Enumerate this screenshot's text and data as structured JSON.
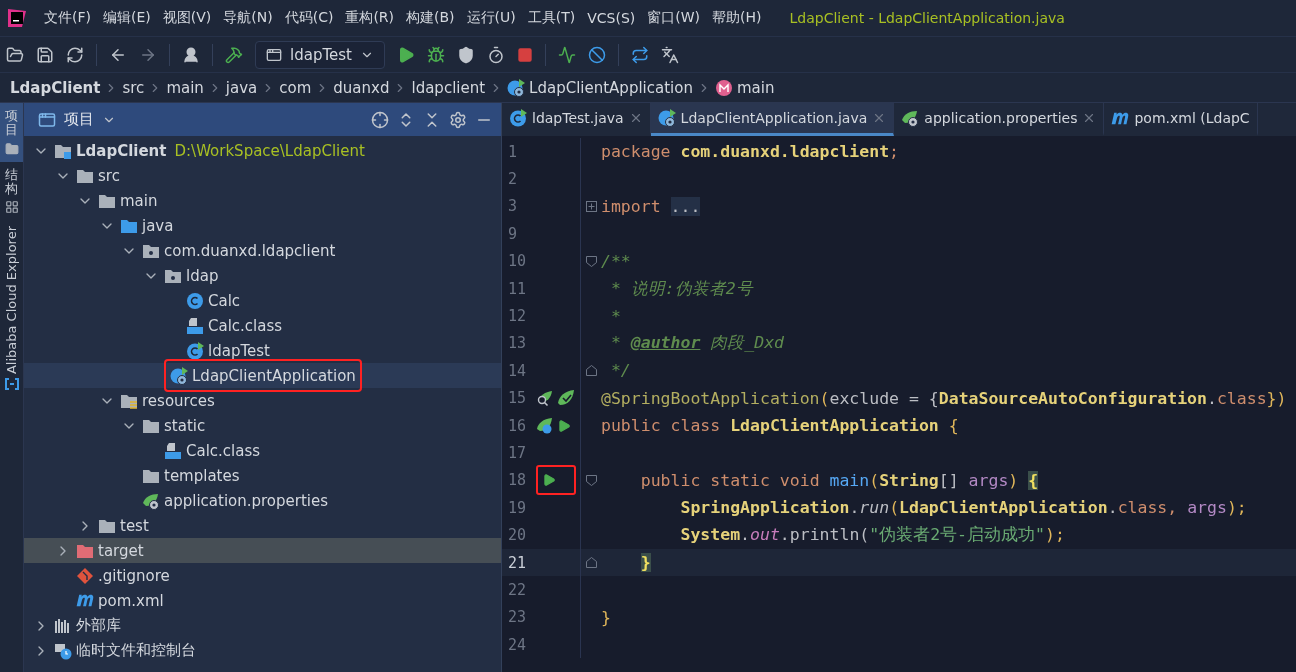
{
  "window": {
    "title": "LdapClient - LdapClientApplication.java"
  },
  "menu": [
    "文件(F)",
    "编辑(E)",
    "视图(V)",
    "导航(N)",
    "代码(C)",
    "重构(R)",
    "构建(B)",
    "运行(U)",
    "工具(T)",
    "VCS(S)",
    "窗口(W)",
    "帮助(H)"
  ],
  "toolbar": {
    "run_config": "ldapTest"
  },
  "breadcrumb": [
    {
      "label": "LdapClient",
      "kind": "project"
    },
    {
      "label": "src",
      "kind": "plain"
    },
    {
      "label": "main",
      "kind": "plain"
    },
    {
      "label": "java",
      "kind": "plain"
    },
    {
      "label": "com",
      "kind": "plain"
    },
    {
      "label": "duanxd",
      "kind": "plain"
    },
    {
      "label": "ldapclient",
      "kind": "plain"
    },
    {
      "label": "LdapClientApplication",
      "kind": "spring-class"
    },
    {
      "label": "main",
      "kind": "method"
    }
  ],
  "tool_strip": [
    {
      "label": "项目",
      "kind": "project",
      "selected": true
    },
    {
      "label": "结构",
      "kind": "structure",
      "selected": false
    },
    {
      "label": "Alibaba Cloud Explorer",
      "kind": "cloud",
      "selected": false
    }
  ],
  "project_panel": {
    "title": "项目",
    "tree": [
      {
        "label": "LdapClient",
        "path": "D:\\WorkSpace\\LdapClient",
        "kind": "module",
        "expanded": true,
        "selected": false,
        "children": [
          {
            "label": "src",
            "kind": "folder",
            "expanded": true,
            "selected": false,
            "children": [
              {
                "label": "main",
                "kind": "folder",
                "expanded": true,
                "selected": false,
                "children": [
                  {
                    "label": "java",
                    "kind": "source-folder",
                    "expanded": true,
                    "selected": false,
                    "children": [
                      {
                        "label": "com.duanxd.ldapclient",
                        "kind": "package",
                        "expanded": true,
                        "selected": false,
                        "children": [
                          {
                            "label": "ldap",
                            "kind": "package",
                            "expanded": true,
                            "selected": false,
                            "children": [
                              {
                                "label": "Calc",
                                "kind": "class",
                                "selected": false
                              },
                              {
                                "label": "Calc.class",
                                "kind": "class-file",
                                "selected": false
                              },
                              {
                                "label": "ldapTest",
                                "kind": "runnable-class",
                                "selected": false
                              }
                            ]
                          },
                          {
                            "label": "LdapClientApplication",
                            "kind": "spring-class",
                            "selected": false,
                            "hovered": true,
                            "highlighted": true
                          }
                        ]
                      }
                    ]
                  },
                  {
                    "label": "resources",
                    "kind": "resources-folder",
                    "expanded": true,
                    "selected": false,
                    "children": [
                      {
                        "label": "static",
                        "kind": "folder",
                        "expanded": true,
                        "selected": false,
                        "children": [
                          {
                            "label": "Calc.class",
                            "kind": "class-file",
                            "selected": false
                          }
                        ]
                      },
                      {
                        "label": "templates",
                        "kind": "folder",
                        "selected": false
                      },
                      {
                        "label": "application.properties",
                        "kind": "spring-props",
                        "selected": false
                      }
                    ]
                  }
                ]
              },
              {
                "label": "test",
                "kind": "folder",
                "expanded": false,
                "selected": false
              }
            ]
          },
          {
            "label": "target",
            "kind": "excluded-folder",
            "expanded": false,
            "selected": true
          },
          {
            "label": ".gitignore",
            "kind": "git",
            "selected": false
          },
          {
            "label": "pom.xml",
            "kind": "maven",
            "selected": false
          }
        ]
      },
      {
        "label": "外部库",
        "kind": "library",
        "expanded": false,
        "selected": false
      },
      {
        "label": "临时文件和控制台",
        "kind": "scratches",
        "expanded": false,
        "selected": false
      }
    ]
  },
  "editor_tabs": [
    {
      "label": "ldapTest.java",
      "kind": "runnable-class",
      "selected": false,
      "closable": true
    },
    {
      "label": "LdapClientApplication.java",
      "kind": "spring-class",
      "selected": true,
      "closable": true
    },
    {
      "label": "application.properties",
      "kind": "spring-props",
      "selected": false,
      "closable": true
    },
    {
      "label": "pom.xml (LdapC",
      "kind": "maven",
      "selected": false,
      "closable": false
    }
  ],
  "code": [
    {
      "number": "1",
      "tokens": [
        {
          "text": "package ",
          "kind": "keyword"
        },
        {
          "text": "com.duanxd.ldapclient",
          "kind": "type"
        },
        {
          "text": ";",
          "kind": "keyword"
        }
      ]
    },
    {
      "number": "2"
    },
    {
      "number": "3",
      "folded": true,
      "tokens": [
        {
          "text": "import ",
          "kind": "keyword"
        },
        {
          "text": "...",
          "kind": "folded"
        }
      ]
    },
    {
      "number": "9"
    },
    {
      "number": "10",
      "fold_start": true,
      "tokens": [
        {
          "text": "/**",
          "kind": "comment"
        }
      ]
    },
    {
      "number": "11",
      "tokens": [
        {
          "text": " * 说明:伪装者2号",
          "kind": "comment"
        }
      ]
    },
    {
      "number": "12",
      "tokens": [
        {
          "text": " *",
          "kind": "comment"
        }
      ]
    },
    {
      "number": "13",
      "tokens": [
        {
          "text": " * ",
          "kind": "comment"
        },
        {
          "text": "@author",
          "kind": "doc-tag"
        },
        {
          "text": " 肉段_Dxd",
          "kind": "comment"
        }
      ]
    },
    {
      "number": "14",
      "fold_end": true,
      "tokens": [
        {
          "text": " */",
          "kind": "comment"
        }
      ]
    },
    {
      "number": "15",
      "gutter": [
        {
          "kind": "bean-search"
        },
        {
          "kind": "bean"
        }
      ],
      "tokens": [
        {
          "text": "@SpringBootApplication",
          "kind": "annotation"
        },
        {
          "text": "(",
          "kind": "punct"
        },
        {
          "text": "exclude = ",
          "kind": "plain"
        },
        {
          "text": "{",
          "kind": "plain"
        },
        {
          "text": "DataSourceAutoConfiguration",
          "kind": "type"
        },
        {
          "text": ".",
          "kind": "plain"
        },
        {
          "text": "class",
          "kind": "keyword"
        },
        {
          "text": "})",
          "kind": "punct"
        }
      ]
    },
    {
      "number": "16",
      "gutter": [
        {
          "kind": "spring-class"
        },
        {
          "kind": "run"
        }
      ],
      "tokens": [
        {
          "text": "public class ",
          "kind": "keyword"
        },
        {
          "text": "LdapClientApplication",
          "kind": "type"
        },
        {
          "text": " {",
          "kind": "punct"
        }
      ]
    },
    {
      "number": "17"
    },
    {
      "number": "18",
      "gutter": [
        {
          "kind": "run"
        }
      ],
      "highlighted": true,
      "fold_start": true,
      "tokens": [
        {
          "text": "    public static void ",
          "kind": "keyword"
        },
        {
          "text": "main",
          "kind": "method"
        },
        {
          "text": "(",
          "kind": "punct"
        },
        {
          "text": "String",
          "kind": "type"
        },
        {
          "text": "[] ",
          "kind": "plain"
        },
        {
          "text": "args",
          "kind": "param"
        },
        {
          "text": ") ",
          "kind": "punct"
        },
        {
          "text": "{",
          "kind": "brace-match"
        }
      ]
    },
    {
      "number": "19",
      "tokens": [
        {
          "text": "        SpringApplication",
          "kind": "type"
        },
        {
          "text": ".",
          "kind": "plain"
        },
        {
          "text": "run",
          "kind": "static-call"
        },
        {
          "text": "(",
          "kind": "punct"
        },
        {
          "text": "LdapClientApplication",
          "kind": "type"
        },
        {
          "text": ".",
          "kind": "plain"
        },
        {
          "text": "class",
          "kind": "keyword"
        },
        {
          "text": ", ",
          "kind": "keyword"
        },
        {
          "text": "args",
          "kind": "param"
        },
        {
          "text": ");",
          "kind": "punct"
        }
      ]
    },
    {
      "number": "20",
      "tokens": [
        {
          "text": "        System",
          "kind": "type"
        },
        {
          "text": ".",
          "kind": "plain"
        },
        {
          "text": "out",
          "kind": "static-field"
        },
        {
          "text": ".println(",
          "kind": "plain"
        },
        {
          "text": "\"伪装者2号-启动成功\"",
          "kind": "string"
        },
        {
          "text": ");",
          "kind": "punct"
        }
      ]
    },
    {
      "number": "21",
      "current": true,
      "fold_end": true,
      "tokens": [
        {
          "text": "    }",
          "kind": "brace-match"
        }
      ]
    },
    {
      "number": "22"
    },
    {
      "number": "23",
      "tokens": [
        {
          "text": "}",
          "kind": "punct"
        }
      ]
    },
    {
      "number": "24"
    }
  ]
}
